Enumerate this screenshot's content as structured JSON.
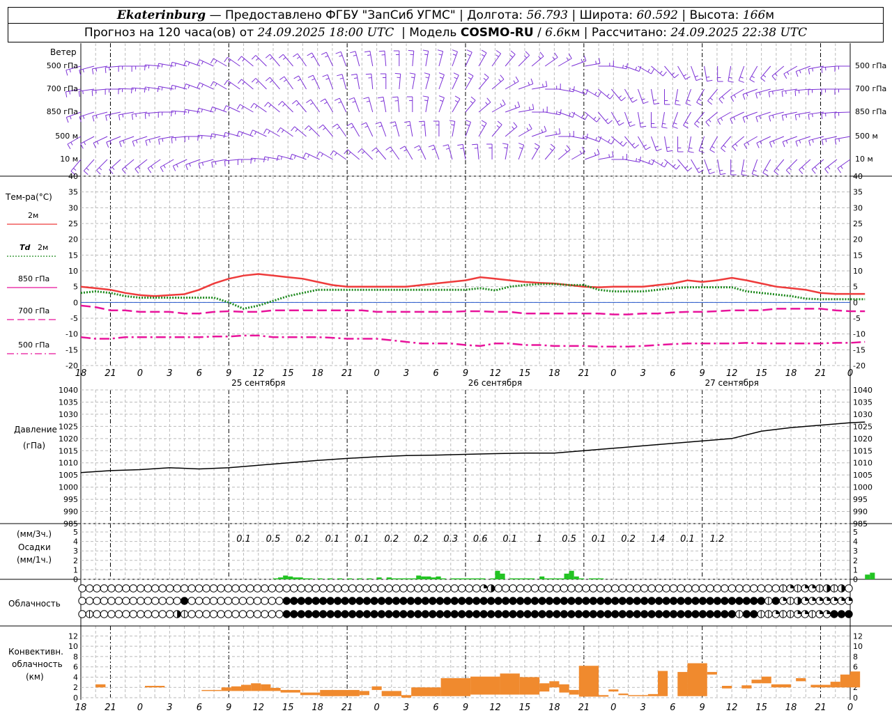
{
  "header": {
    "station": "Ekaterinburg",
    "provider_sep": " — ",
    "provider": "Предоставлено ФГБУ \"ЗапСиб УГМС\"",
    "lon_label": "Долгота:",
    "lon": "56.793",
    "lat_label": "Широта:",
    "lat": "60.592",
    "alt_label": "Высота:",
    "alt": "166",
    "alt_unit": "м",
    "forecast_label": "Прогноз на 120 часа(ов) от",
    "forecast_from": "24.09.2025 18:00 UTC",
    "model_label": "Модель",
    "model": "COSMO-RU",
    "model_res": "6.6",
    "model_res_unit": "км",
    "computed_label": "Рассчитано:",
    "computed": "24.09.2025 22:38 UTC"
  },
  "time_axis": {
    "hour_labels": [
      "18",
      "21",
      "0",
      "3",
      "6",
      "9",
      "12",
      "15",
      "18",
      "21",
      "0",
      "3",
      "6",
      "9",
      "12",
      "15",
      "18",
      "21",
      "0",
      "3",
      "6",
      "9",
      "12",
      "15",
      "18",
      "21",
      "0"
    ],
    "day_labels": [
      "25 сентября",
      "26 сентября",
      "27 сентября"
    ]
  },
  "wind_panel": {
    "title": "Ветер",
    "levels": [
      "500 гПа",
      "700 гПа",
      "850 гПа",
      "500 м",
      "10 м"
    ],
    "right_levels": [
      "500 гПа",
      "700 гПа",
      "850 гПа",
      "500 м",
      "10 м"
    ],
    "color": "#7b2fd6"
  },
  "temp_panel": {
    "title": "Тем-ра(°С)",
    "legend": [
      {
        "label": "2м",
        "color": "#ee3b3b",
        "style": "solid"
      },
      {
        "label": "Td",
        "label2": "2м",
        "color": "#1e8a1e",
        "style": "dotted"
      },
      {
        "label": "850 гПа",
        "color": "#e8139b",
        "style": "solid"
      },
      {
        "label": "700 гПа",
        "color": "#e8139b",
        "style": "dash"
      },
      {
        "label": "500 гПа",
        "color": "#e8139b",
        "style": "dashdot"
      }
    ],
    "y_ticks": [
      "40",
      "35",
      "30",
      "25",
      "20",
      "15",
      "10",
      "5",
      "0",
      "-5",
      "-10",
      "-15",
      "-20"
    ]
  },
  "pressure_panel": {
    "title": "Давление",
    "unit": "(гПа)",
    "y_ticks": [
      "1040",
      "1035",
      "1030",
      "1025",
      "1020",
      "1015",
      "1010",
      "1005",
      "1000",
      "995",
      "990",
      "985"
    ]
  },
  "precip_panel": {
    "title_top": "(мм/3ч.)",
    "title": "Осадки",
    "title_bottom": "(мм/1ч.)",
    "y_ticks": [
      "5",
      "4",
      "3",
      "2",
      "1",
      "0"
    ],
    "bar_color": "#22c322",
    "totals": [
      "0.1",
      "0.5",
      "0.2",
      "0.1",
      "0.1",
      "0.2",
      "0.2",
      "0.3",
      "0.6",
      "0.1",
      "1",
      "0.5",
      "0.1",
      "0.2",
      "1.4",
      "0.1",
      "1.2"
    ]
  },
  "cloud_panel": {
    "title": "Облачность"
  },
  "conv_panel": {
    "title1": "Конвективн.",
    "title2": "облачность",
    "title3": "(км)",
    "y_ticks": [
      "12",
      "10",
      "8",
      "6",
      "4",
      "2",
      "0"
    ],
    "bar_color": "#f08a2e"
  },
  "chart_data": [
    {
      "type": "line",
      "title": "Тем-ра(°С)",
      "x_hours_from_start": [
        0,
        3,
        6,
        9,
        12,
        15,
        18,
        21,
        24,
        27,
        30,
        33,
        36,
        39,
        42,
        45,
        48,
        51,
        54,
        57,
        60,
        63,
        66,
        69,
        72,
        75,
        78,
        81,
        84,
        87,
        90,
        93,
        96,
        99,
        102,
        105,
        108,
        111,
        114,
        117,
        120,
        123,
        126,
        129,
        132,
        135,
        138,
        141,
        144,
        147,
        150,
        153,
        156,
        159
      ],
      "ylim": [
        -20,
        40
      ],
      "series": [
        {
          "name": "2м",
          "values": [
            5,
            4.5,
            4,
            3,
            2.3,
            2,
            2.3,
            2.6,
            4,
            6,
            7.5,
            8.5,
            9,
            8.5,
            8,
            7.5,
            6.5,
            5.5,
            5,
            5,
            5,
            5,
            5,
            5.5,
            6,
            6.5,
            7,
            8,
            7.5,
            7,
            6.5,
            6.2,
            6,
            5.5,
            5,
            4.8,
            5,
            5,
            5,
            5.5,
            6,
            7,
            6.5,
            7,
            7.8,
            7,
            6,
            5,
            4.5,
            4,
            3,
            2.7,
            2.7,
            2.7
          ]
        },
        {
          "name": "Td 2м",
          "values": [
            3,
            3.5,
            3,
            2,
            1.5,
            1.5,
            1.5,
            1.5,
            1.5,
            1.5,
            0,
            -2,
            -1,
            0.5,
            2,
            3,
            4,
            4,
            4,
            4,
            4,
            4,
            4,
            4,
            4,
            4,
            4,
            4.5,
            3.8,
            5,
            5.5,
            5.8,
            5.8,
            5.5,
            5.5,
            4,
            3.5,
            3.5,
            3.5,
            4,
            4.5,
            4.8,
            4.8,
            4.8,
            4.8,
            3.5,
            3,
            2.5,
            2,
            1.2,
            1,
            1,
            1,
            1
          ]
        },
        {
          "name": "850 гПа",
          "values": [
            -1,
            -1.5,
            -2.5,
            -2.5,
            -3,
            -3,
            -3,
            -3.5,
            -3.5,
            -3,
            -2.8,
            -3,
            -3,
            -2.5,
            -2.5,
            -2.5,
            -2.5,
            -2.5,
            -2.5,
            -2.5,
            -3,
            -3,
            -3,
            -3,
            -3,
            -3,
            -2.8,
            -2.8,
            -3,
            -3,
            -3.5,
            -3.5,
            -3.5,
            -3.5,
            -3.5,
            -3.5,
            -3.8,
            -3.8,
            -3.5,
            -3.5,
            -3.2,
            -3,
            -3,
            -2.8,
            -2.5,
            -2.5,
            -2.5,
            -2,
            -2,
            -2,
            -2,
            -2.5,
            -2.8,
            -2.8
          ]
        },
        {
          "name": "700 гПа",
          "values": [
            -11,
            -11.5,
            -11.5,
            -11,
            -11,
            -11,
            -11,
            -11,
            -11,
            -10.8,
            -10.8,
            -10.5,
            -10.5,
            -11,
            -11,
            -11,
            -11,
            -11.2,
            -11.5,
            -11.5,
            -11.5,
            -12,
            -12.5,
            -13,
            -13,
            -13,
            -13.5,
            -13.8,
            -13,
            -13,
            -13.5,
            -13.5,
            -13.8,
            -13.8,
            -13.8,
            -14,
            -14,
            -14,
            -13.8,
            -13.5,
            -13.2,
            -13,
            -13,
            -13,
            -13,
            -12.8,
            -13,
            -13,
            -13,
            -13,
            -13,
            -12.8,
            -12.8,
            -12.5
          ]
        }
      ]
    },
    {
      "type": "line",
      "title": "Давление",
      "ylabel": "(гПа)",
      "ylim": [
        985,
        1040
      ],
      "x_hours_from_start": [
        0,
        6,
        12,
        18,
        24,
        30,
        36,
        42,
        48,
        54,
        60,
        66,
        72,
        78,
        84,
        90,
        96,
        102,
        108,
        114,
        120,
        126,
        132,
        138,
        144,
        150,
        156,
        159
      ],
      "series": [
        {
          "name": "Давление",
          "values": [
            1006,
            1006.8,
            1007.2,
            1008,
            1007.5,
            1008,
            1009,
            1010,
            1011,
            1011.8,
            1012.5,
            1013,
            1013.2,
            1013.5,
            1013.8,
            1014,
            1014,
            1015,
            1016,
            1017,
            1018,
            1019,
            1020,
            1023,
            1024.5,
            1025.5,
            1026.5,
            1026.8
          ]
        }
      ]
    },
    {
      "type": "bar",
      "title": "Осадки",
      "ylabel": "(мм/1ч.)",
      "ylim": [
        0,
        5
      ],
      "x_hours_from_start": [
        39,
        40,
        41,
        42,
        43,
        44,
        45,
        46,
        48,
        50,
        52,
        54,
        56,
        58,
        60,
        62,
        63,
        64,
        65,
        66,
        67,
        68,
        69,
        70,
        71,
        72,
        73,
        75,
        76,
        77,
        78,
        79,
        80,
        81,
        83,
        84,
        85,
        87,
        88,
        89,
        90,
        91,
        93,
        94,
        95,
        96,
        97,
        98,
        99,
        100,
        101,
        103,
        104,
        105,
        159,
        160
      ],
      "values": [
        0.1,
        0.2,
        0.4,
        0.3,
        0.2,
        0.2,
        0.1,
        0.1,
        0.1,
        0.1,
        0.1,
        0.1,
        0.1,
        0.1,
        0.2,
        0.2,
        0.1,
        0.1,
        0.1,
        0.1,
        0.1,
        0.4,
        0.3,
        0.3,
        0.2,
        0.3,
        0.1,
        0.1,
        0.1,
        0.1,
        0.1,
        0.1,
        0.1,
        0.1,
        0.1,
        0.9,
        0.6,
        0.1,
        0.1,
        0.1,
        0.1,
        0.1,
        0.3,
        0.1,
        0.1,
        0.1,
        0.1,
        0.6,
        0.9,
        0.3,
        0.1,
        0.1,
        0.1,
        0.1,
        0.5,
        0.7
      ]
    },
    {
      "type": "bar",
      "title": "Конвективн. облачность",
      "ylabel": "(км)",
      "ylim": [
        0,
        13
      ],
      "bars": [
        {
          "x0": 3,
          "x1": 5,
          "bottom": 2,
          "top": 2.6
        },
        {
          "x0": 13,
          "x1": 17,
          "bottom": 2,
          "top": 2.3
        },
        {
          "x0": 24.5,
          "x1": 28.5,
          "bottom": 1.3,
          "top": 1.5
        },
        {
          "x0": 28.5,
          "x1": 30.5,
          "bottom": 1.3,
          "top": 2
        },
        {
          "x0": 30.5,
          "x1": 32.5,
          "bottom": 1.3,
          "top": 2.2
        },
        {
          "x0": 32.5,
          "x1": 34.5,
          "bottom": 1.3,
          "top": 2.5
        },
        {
          "x0": 34.5,
          "x1": 36.5,
          "bottom": 1.3,
          "top": 2.8
        },
        {
          "x0": 36.5,
          "x1": 38.5,
          "bottom": 1.3,
          "top": 2.6
        },
        {
          "x0": 38.5,
          "x1": 40.5,
          "bottom": 1.3,
          "top": 1.9
        },
        {
          "x0": 40.5,
          "x1": 44.5,
          "bottom": 1,
          "top": 1.5
        },
        {
          "x0": 44.5,
          "x1": 48.5,
          "bottom": 0.5,
          "top": 1
        },
        {
          "x0": 48.5,
          "x1": 56.5,
          "bottom": 0.3,
          "top": 1.5
        },
        {
          "x0": 56.5,
          "x1": 58.5,
          "bottom": 0.5,
          "top": 1.3
        },
        {
          "x0": 59,
          "x1": 61,
          "bottom": 1.5,
          "top": 2.2
        },
        {
          "x0": 61,
          "x1": 65,
          "bottom": 0.3,
          "top": 1.3
        },
        {
          "x0": 65,
          "x1": 67,
          "bottom": 0,
          "top": 0.5
        },
        {
          "x0": 67,
          "x1": 73,
          "bottom": 0.3,
          "top": 2
        },
        {
          "x0": 73,
          "x1": 79,
          "bottom": 0.3,
          "top": 3.8
        },
        {
          "x0": 79,
          "x1": 85,
          "bottom": 0.6,
          "top": 4.1
        },
        {
          "x0": 85,
          "x1": 89,
          "bottom": 0.6,
          "top": 4.7
        },
        {
          "x0": 89,
          "x1": 93,
          "bottom": 0.6,
          "top": 4
        },
        {
          "x0": 93,
          "x1": 95,
          "bottom": 1.2,
          "top": 2.8
        },
        {
          "x0": 95,
          "x1": 97,
          "bottom": 2,
          "top": 3.2
        },
        {
          "x0": 97,
          "x1": 99,
          "bottom": 1,
          "top": 2.6
        },
        {
          "x0": 99,
          "x1": 101,
          "bottom": 0.6,
          "top": 1.5
        },
        {
          "x0": 101,
          "x1": 105,
          "bottom": 0.2,
          "top": 6.2
        },
        {
          "x0": 105,
          "x1": 107,
          "bottom": 0.2,
          "top": 0.5
        },
        {
          "x0": 107,
          "x1": 109,
          "bottom": 1.2,
          "top": 1.6
        },
        {
          "x0": 109,
          "x1": 111,
          "bottom": 0.5,
          "top": 0.8
        },
        {
          "x0": 111,
          "x1": 115,
          "bottom": 0.3,
          "top": 0.5
        },
        {
          "x0": 115,
          "x1": 117,
          "bottom": 0.3,
          "top": 0.7
        },
        {
          "x0": 117,
          "x1": 119,
          "bottom": 0.3,
          "top": 5.2
        },
        {
          "x0": 121,
          "x1": 123,
          "bottom": 0.3,
          "top": 5
        },
        {
          "x0": 123,
          "x1": 127,
          "bottom": 0.3,
          "top": 6.7
        },
        {
          "x0": 127,
          "x1": 129,
          "bottom": 4.5,
          "top": 5
        },
        {
          "x0": 130,
          "x1": 132,
          "bottom": 1.8,
          "top": 2.3
        },
        {
          "x0": 134,
          "x1": 136,
          "bottom": 1.8,
          "top": 2.4
        },
        {
          "x0": 136,
          "x1": 138,
          "bottom": 2.8,
          "top": 3.5
        },
        {
          "x0": 138,
          "x1": 140,
          "bottom": 2.8,
          "top": 4.1
        },
        {
          "x0": 140,
          "x1": 144,
          "bottom": 2,
          "top": 2.6
        },
        {
          "x0": 145,
          "x1": 147,
          "bottom": 3.2,
          "top": 3.8
        },
        {
          "x0": 148,
          "x1": 152,
          "bottom": 2,
          "top": 2.5
        },
        {
          "x0": 152,
          "x1": 154,
          "bottom": 2,
          "top": 3.1
        },
        {
          "x0": 154,
          "x1": 156,
          "bottom": 2,
          "top": 4.5
        },
        {
          "x0": 156,
          "x1": 158,
          "bottom": 2,
          "top": 5.1
        }
      ]
    }
  ]
}
